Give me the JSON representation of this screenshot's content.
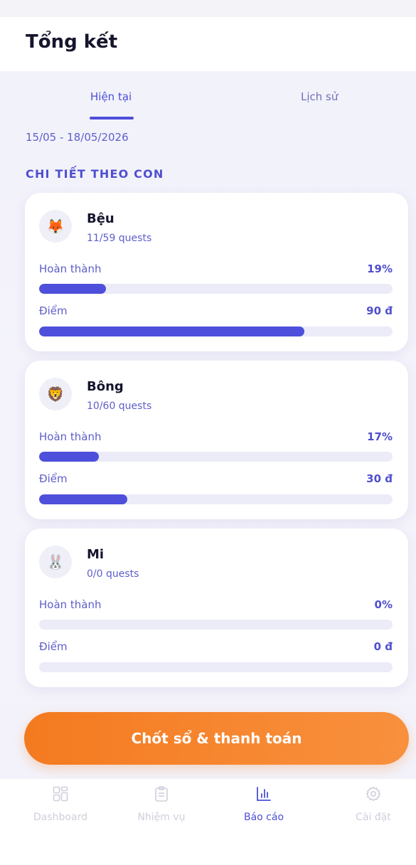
{
  "header": {
    "title": "Tổng kết"
  },
  "tabs": [
    {
      "label": "Hiện tại",
      "active": true
    },
    {
      "label": "Lịch sử",
      "active": false
    }
  ],
  "date_range": "15/05 - 18/05/2026",
  "section_title": "CHI TIẾT THEO CON",
  "kids": [
    {
      "name": "Bệu",
      "avatar": "fox-face-icon",
      "avatar_glyph": "🦊",
      "quests": "11/59 quests",
      "completion_label": "Hoàn thành",
      "completion_value": "19%",
      "completion_fraction": 0.19,
      "points_label": "Điểm",
      "points_value": "90 đ",
      "points_fraction": 0.75
    },
    {
      "name": "Bông",
      "avatar": "lion-face-icon",
      "avatar_glyph": "🦁",
      "quests": "10/60 quests",
      "completion_label": "Hoàn thành",
      "completion_value": "17%",
      "completion_fraction": 0.17,
      "points_label": "Điểm",
      "points_value": "30 đ",
      "points_fraction": 0.25
    },
    {
      "name": "Mi",
      "avatar": "rabbit-face-icon",
      "avatar_glyph": "🐰",
      "quests": "0/0 quests",
      "completion_label": "Hoàn thành",
      "completion_value": "0%",
      "completion_fraction": 0,
      "points_label": "Điểm",
      "points_value": "0 đ",
      "points_fraction": 0
    }
  ],
  "cta_label": "Chốt sổ & thanh toán",
  "nav": [
    {
      "label": "Dashboard",
      "icon": "dashboard-grid-icon",
      "active": false
    },
    {
      "label": "Nhiệm vụ",
      "icon": "clipboard-list-icon",
      "active": false
    },
    {
      "label": "Báo cáo",
      "icon": "bar-chart-icon",
      "active": true
    },
    {
      "label": "Cài đặt",
      "icon": "gear-icon",
      "active": false
    }
  ],
  "colors": {
    "accent": "#4e4fdb",
    "cta_orange": "#f47a1f",
    "bar_track": "#ecebf8",
    "nav_inactive": "#cfcfdc"
  }
}
